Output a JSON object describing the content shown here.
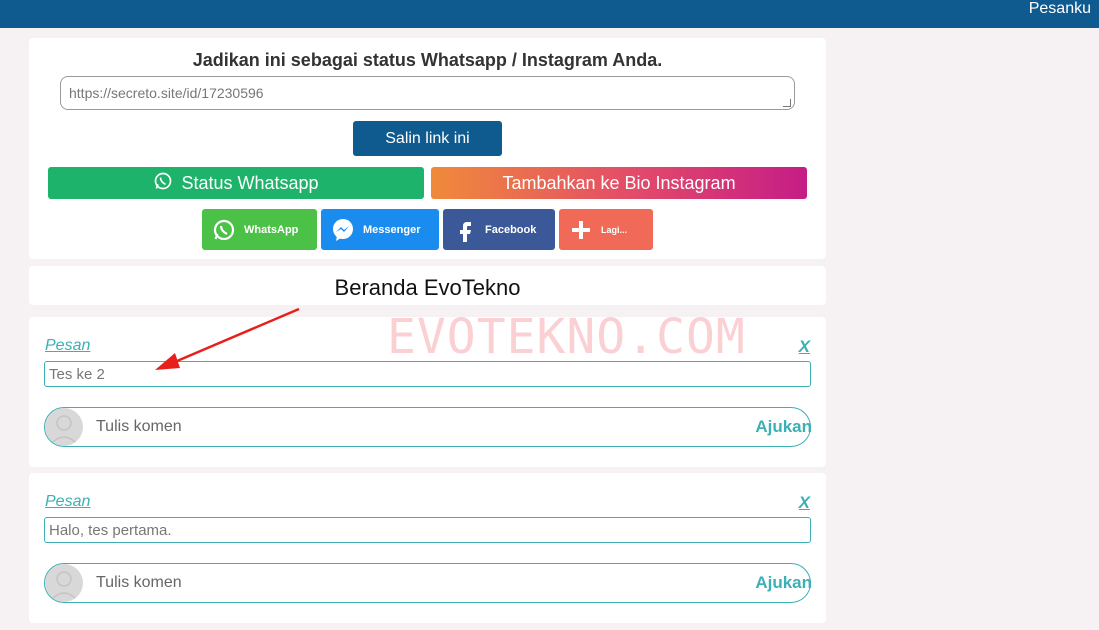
{
  "topbar": {
    "menu_link": "Pesanku"
  },
  "share": {
    "title": "Jadikan ini sebagai status Whatsapp / Instagram Anda.",
    "link_value": "https://secreto.site/id/17230596",
    "copy_label": "Salin link ini",
    "wa_status_label": "Status Whatsapp",
    "ig_bio_label": "Tambahkan ke Bio Instagram",
    "buttons": [
      {
        "label": "WhatsApp",
        "icon": "whatsapp-icon"
      },
      {
        "label": "Messenger",
        "icon": "messenger-icon"
      },
      {
        "label": "Facebook",
        "icon": "facebook-icon"
      },
      {
        "label": "Lagi...",
        "icon": "plus-icon"
      }
    ]
  },
  "home": {
    "title": "Beranda EvoTekno"
  },
  "watermark": "EVOTEKNO.COM",
  "messages": [
    {
      "label": "Pesan",
      "close": "X",
      "text": "Tes ke 2",
      "comment_placeholder": "Tulis komen",
      "submit": "Ajukan"
    },
    {
      "label": "Pesan",
      "close": "X",
      "text": "Halo, tes pertama.",
      "comment_placeholder": "Tulis komen",
      "submit": "Ajukan"
    }
  ],
  "colors": {
    "topbar": "#0f5b8f",
    "accent": "#3bb0b5",
    "whatsapp": "#1eb36b",
    "arrow": "#e8201c"
  }
}
